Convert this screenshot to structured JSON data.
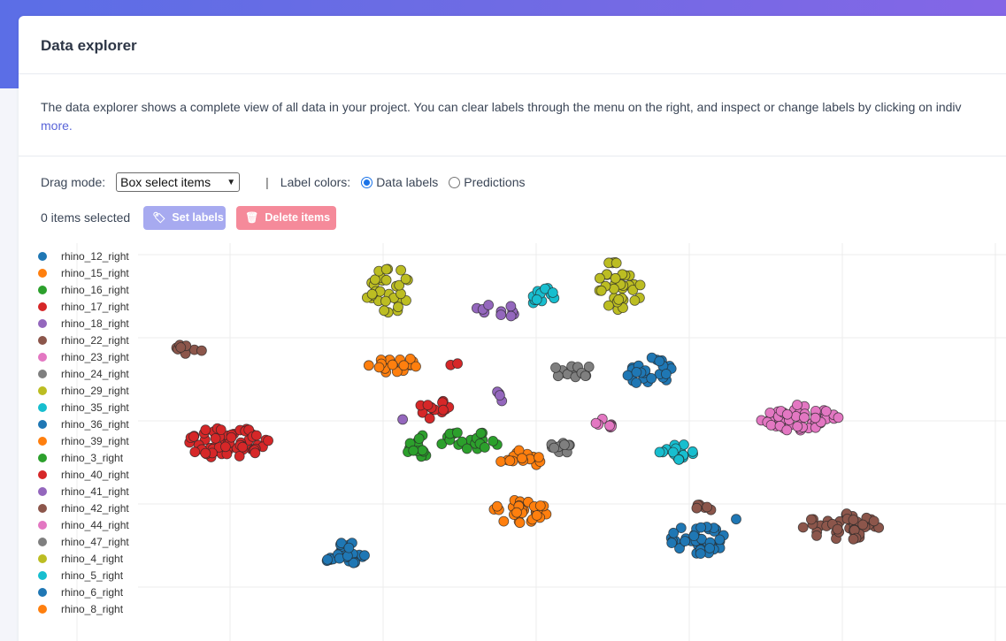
{
  "header": {
    "title": "Data explorer"
  },
  "description": {
    "text": "The data explorer shows a complete view of all data in your project. You can clear labels through the menu on the right, and inspect or change labels by clicking on indiv",
    "link": "more."
  },
  "controls": {
    "drag_mode_label": "Drag mode:",
    "drag_mode_value": "Box select items",
    "separator": "|",
    "label_colors_label": "Label colors:",
    "radio_data_labels": "Data labels",
    "radio_predictions": "Predictions",
    "selected_count": "0 items selected",
    "set_labels": "Set labels",
    "delete_items": "Delete items"
  },
  "colors": {
    "accent": "#5964d8",
    "set_labels_btn": "#a7aaf0",
    "delete_btn": "#f58a9a"
  },
  "chart_data": {
    "type": "scatter",
    "grid": true,
    "legend_position": "left",
    "series": [
      {
        "name": "rhino_12_right",
        "color": "#1f77b4"
      },
      {
        "name": "rhino_15_right",
        "color": "#ff7f0e"
      },
      {
        "name": "rhino_16_right",
        "color": "#2ca02c"
      },
      {
        "name": "rhino_17_right",
        "color": "#d62728"
      },
      {
        "name": "rhino_18_right",
        "color": "#9467bd"
      },
      {
        "name": "rhino_22_right",
        "color": "#8c564b"
      },
      {
        "name": "rhino_23_right",
        "color": "#e377c2"
      },
      {
        "name": "rhino_24_right",
        "color": "#7f7f7f"
      },
      {
        "name": "rhino_29_right",
        "color": "#bcbd22"
      },
      {
        "name": "rhino_35_right",
        "color": "#17becf"
      },
      {
        "name": "rhino_36_right",
        "color": "#1f77b4"
      },
      {
        "name": "rhino_39_right",
        "color": "#ff7f0e"
      },
      {
        "name": "rhino_3_right",
        "color": "#2ca02c"
      },
      {
        "name": "rhino_40_right",
        "color": "#d62728"
      },
      {
        "name": "rhino_41_right",
        "color": "#9467bd"
      },
      {
        "name": "rhino_42_right",
        "color": "#8c564b"
      },
      {
        "name": "rhino_44_right",
        "color": "#e377c2"
      },
      {
        "name": "rhino_47_right",
        "color": "#7f7f7f"
      },
      {
        "name": "rhino_4_right",
        "color": "#bcbd22"
      },
      {
        "name": "rhino_5_right",
        "color": "#17becf"
      },
      {
        "name": "rhino_6_right",
        "color": "#1f77b4"
      },
      {
        "name": "rhino_8_right",
        "color": "#ff7f0e"
      }
    ]
  }
}
